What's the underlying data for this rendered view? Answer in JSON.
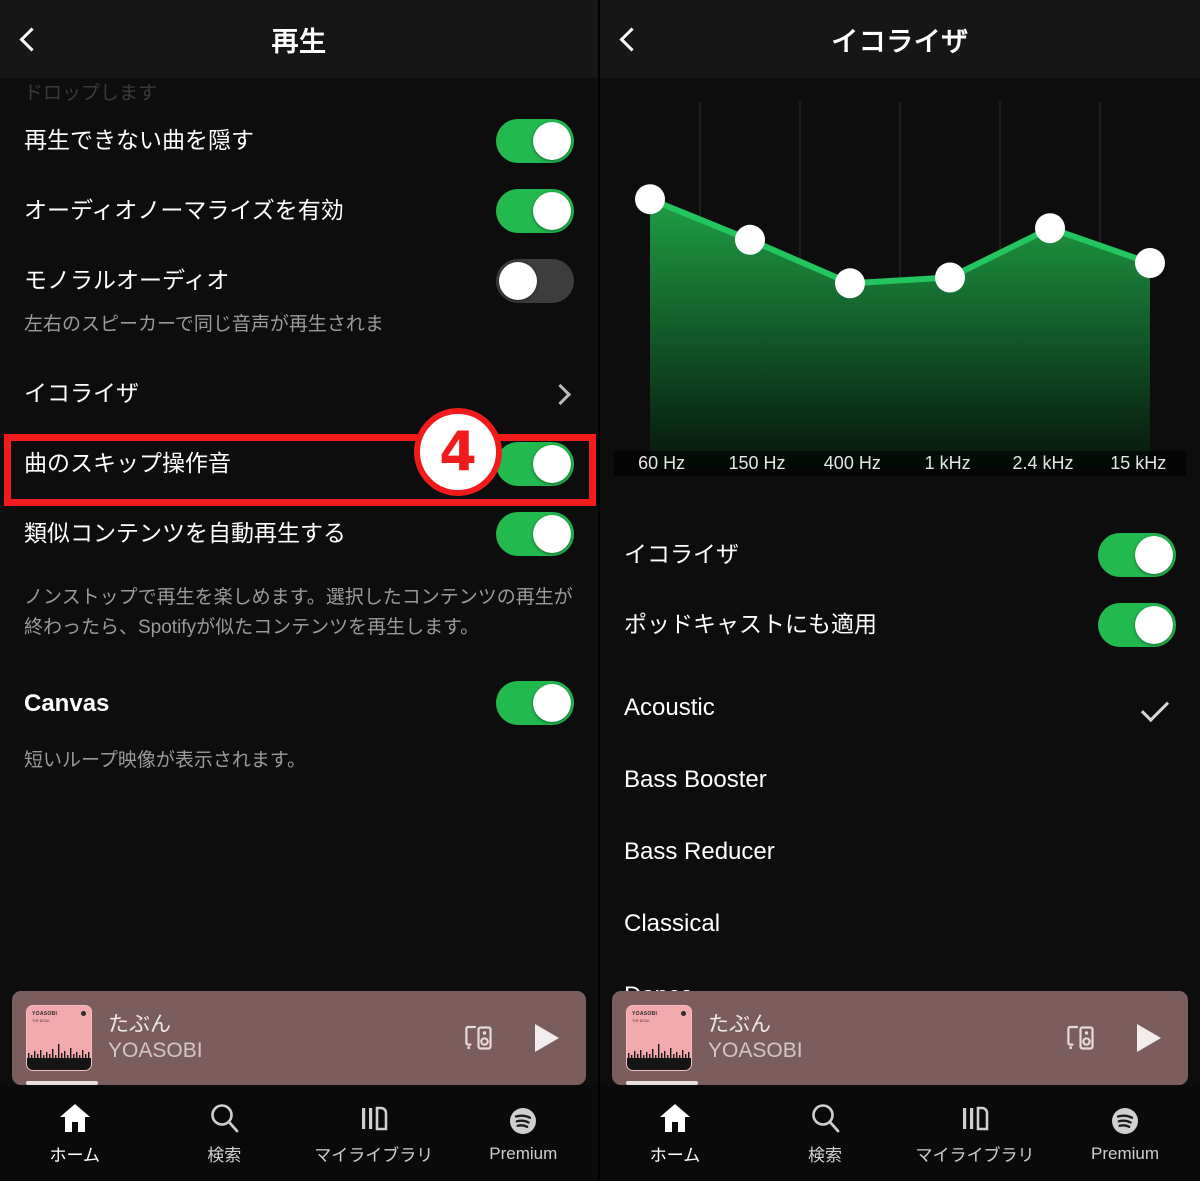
{
  "left_panel": {
    "header": {
      "title": "再生",
      "back_icon": "back-chevron-icon"
    },
    "ghost_row_text": "ドロップします",
    "rows": [
      {
        "label": "再生できない曲を隠す",
        "control": "toggle",
        "state": "on"
      },
      {
        "label": "オーディオノーマライズを有効",
        "control": "toggle",
        "state": "on"
      },
      {
        "label": "モノラルオーディオ",
        "control": "toggle",
        "state": "off"
      }
    ],
    "mono_description": "左右のスピーカーで同じ音声が再生されま",
    "equalizer_row": {
      "label": "イコライザ",
      "control": "chevron"
    },
    "rows_after": [
      {
        "label": "曲のスキップ操作音",
        "control": "toggle",
        "state": "on"
      },
      {
        "label": "類似コンテンツを自動再生する",
        "control": "toggle",
        "state": "on"
      }
    ],
    "autoplay_description": "ノンストップで再生を楽しめます。選択したコンテンツの再生が終わったら、Spotifyが似たコンテンツを再生します。",
    "canvas_row": {
      "label": "Canvas",
      "control": "toggle",
      "state": "on"
    },
    "canvas_description": "短いループ映像が表示されます。",
    "annotation": {
      "number": "4",
      "border_color": "#f21b1b",
      "fill_color": "#ffffff"
    }
  },
  "right_panel": {
    "header": {
      "title": "イコライザ",
      "back_icon": "back-chevron-icon"
    },
    "toggles": [
      {
        "label": "イコライザ",
        "state": "on"
      },
      {
        "label": "ポッドキャストにも適用",
        "state": "on"
      }
    ],
    "presets": [
      {
        "name": "Acoustic",
        "selected": true
      },
      {
        "name": "Bass Booster",
        "selected": false
      },
      {
        "name": "Bass Reducer",
        "selected": false
      },
      {
        "name": "Classical",
        "selected": false
      },
      {
        "name": "Dance",
        "selected": false
      }
    ]
  },
  "chart_data": {
    "type": "line",
    "title": "",
    "xlabel": "",
    "ylabel": "",
    "categories": [
      "60 Hz",
      "150 Hz",
      "400 Hz",
      "1 kHz",
      "2.4 kHz",
      "15 kHz"
    ],
    "values": [
      0.72,
      0.58,
      0.43,
      0.45,
      0.62,
      0.5
    ],
    "ylim": [
      0,
      1
    ],
    "grid": true,
    "legend": "none",
    "line_color": "#22c55e",
    "fill_gradient_top": "#1f9e45",
    "fill_gradient_bottom": "#06150b",
    "handle_color": "#ffffff"
  },
  "miniplayer": {
    "track_title": "たぶん",
    "artist": "YOASOBI",
    "connect_icon": "connect-device-icon",
    "play_icon": "play-icon",
    "background_color": "#7b5d5e",
    "art_color": "#f2a9ab",
    "art_title": "YOASOBI",
    "art_subtitle": "THE BOOK"
  },
  "tabbar": {
    "items": [
      {
        "label": "ホーム",
        "icon": "home-icon",
        "active": true
      },
      {
        "label": "検索",
        "icon": "search-icon",
        "active": false
      },
      {
        "label": "マイライブラリ",
        "icon": "library-icon",
        "active": false
      },
      {
        "label": "Premium",
        "icon": "spotify-logo-icon",
        "active": false
      }
    ]
  }
}
